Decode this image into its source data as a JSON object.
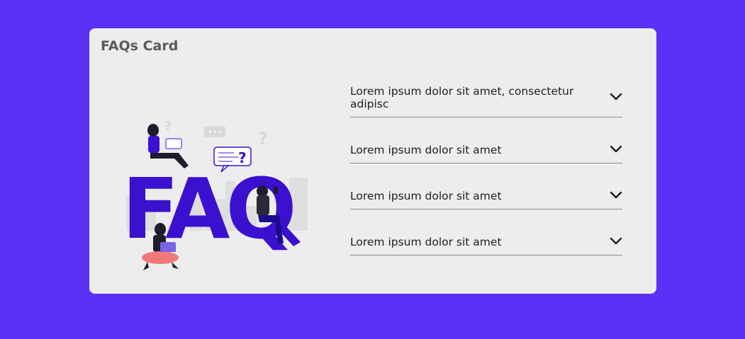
{
  "card": {
    "title": "FAQs Card",
    "illustration_text": "FAQ"
  },
  "faqs": [
    {
      "question": "Lorem ipsum dolor sit amet, consectetur adipisc"
    },
    {
      "question": "Lorem ipsum dolor sit amet"
    },
    {
      "question": "Lorem ipsum dolor sit amet"
    },
    {
      "question": "Lorem ipsum dolor sit amet"
    }
  ],
  "icons": {
    "toggle": "chevron-down-icon"
  },
  "colors": {
    "background": "#5b31f5",
    "card": "#ededed",
    "accent": "#3b10cf",
    "title": "#5a5a5a"
  }
}
